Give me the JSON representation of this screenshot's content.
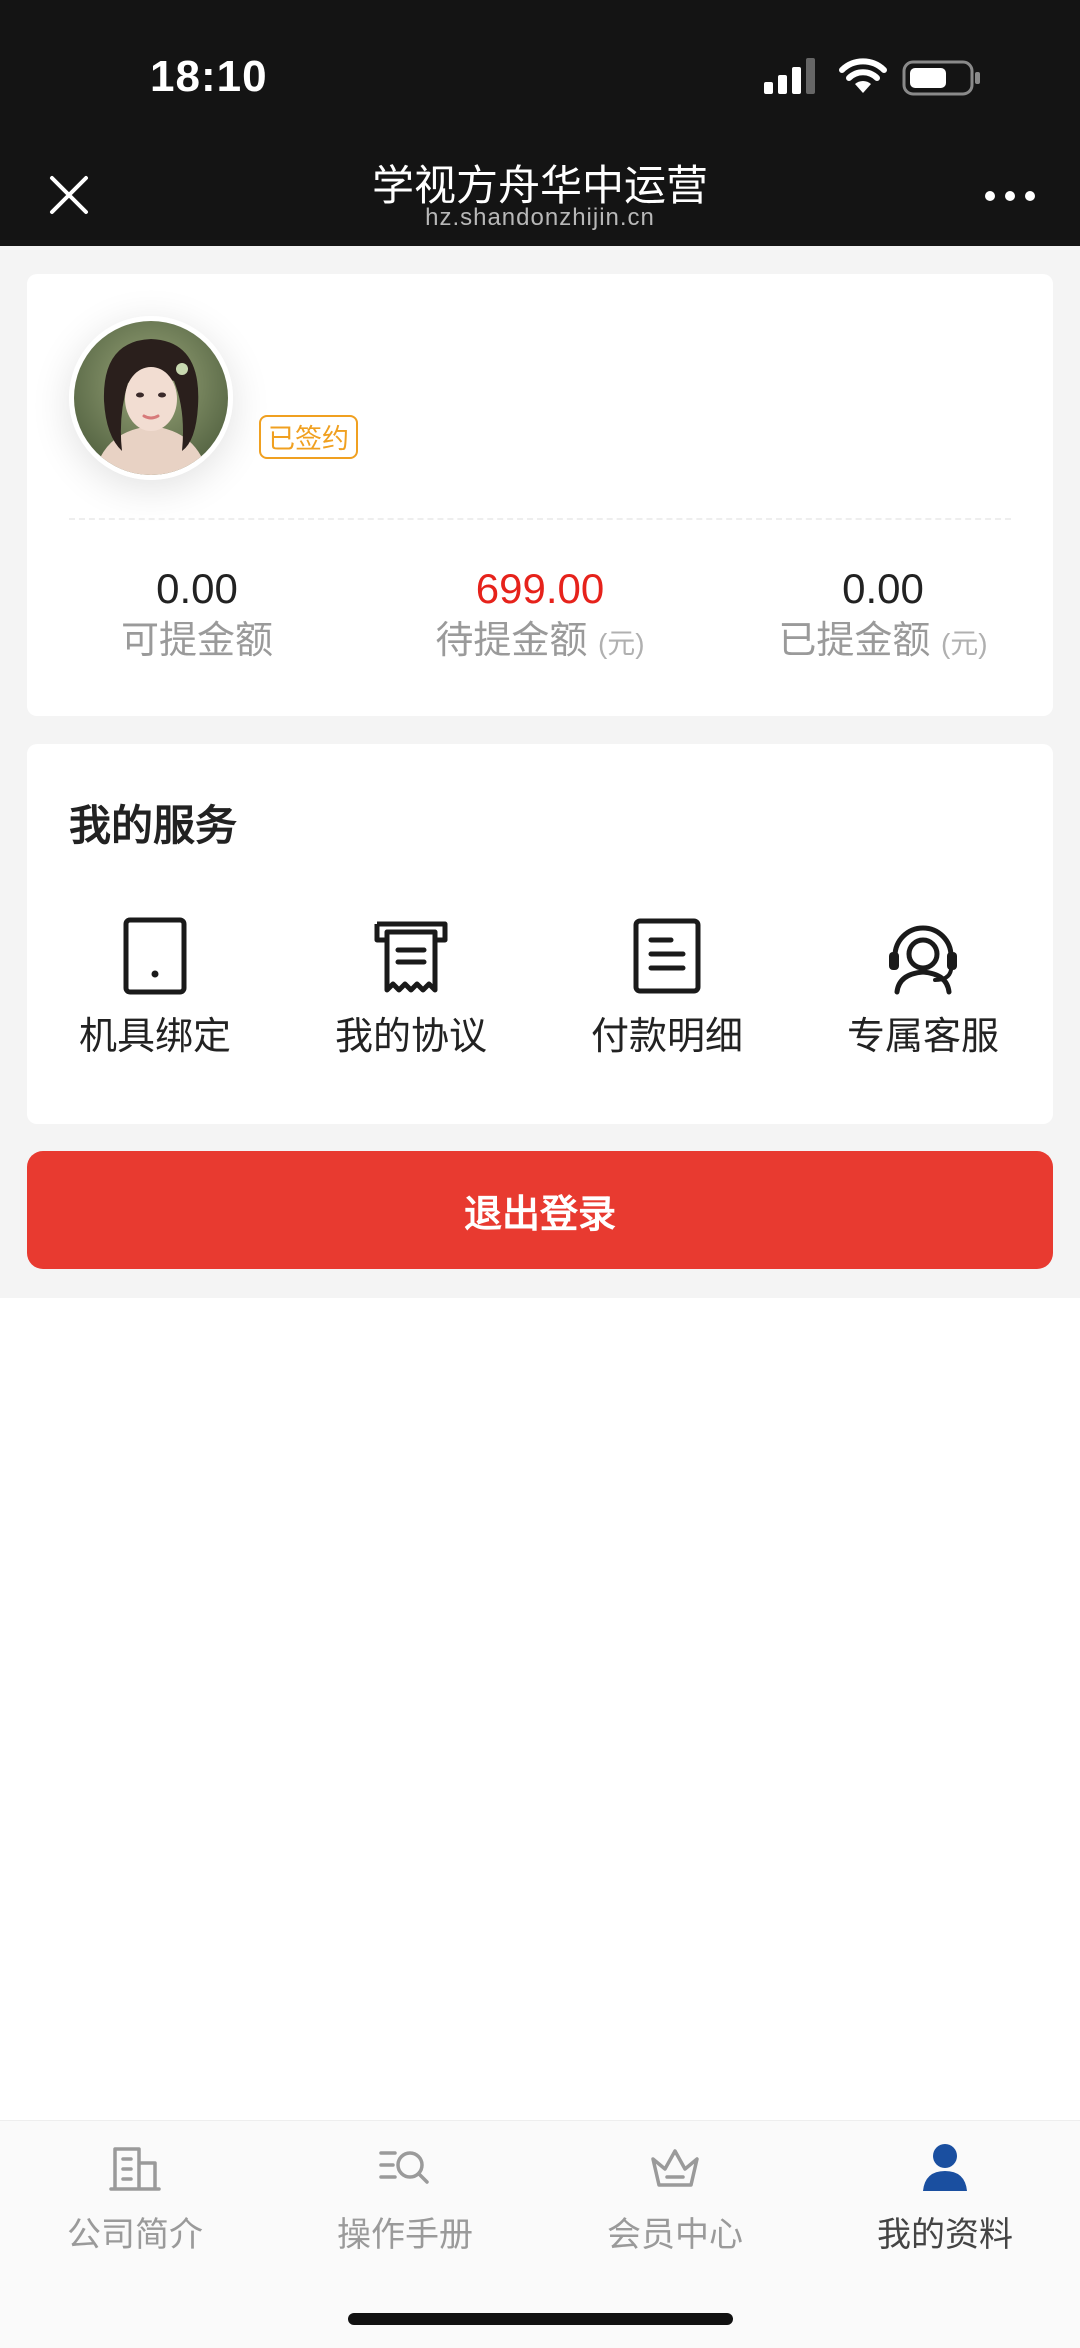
{
  "status_bar": {
    "time": "18:10"
  },
  "nav": {
    "title": "学视方舟华中运营",
    "url": "hz.shandonzhijin.cn"
  },
  "profile": {
    "badge": "已签约",
    "stats": [
      {
        "value": "0.00",
        "label": "可提金额",
        "unit": ""
      },
      {
        "value": "699.00",
        "label": "待提金额",
        "unit": "(元)"
      },
      {
        "value": "0.00",
        "label": "已提金额",
        "unit": "(元)"
      }
    ]
  },
  "services": {
    "title": "我的服务",
    "items": [
      {
        "label": "机具绑定",
        "icon": "tablet-icon"
      },
      {
        "label": "我的协议",
        "icon": "receipt-icon"
      },
      {
        "label": "付款明细",
        "icon": "document-icon"
      },
      {
        "label": "专属客服",
        "icon": "headset-icon"
      }
    ]
  },
  "logout_label": "退出登录",
  "tabs": [
    {
      "label": "公司简介",
      "icon": "building-icon",
      "active": false
    },
    {
      "label": "操作手册",
      "icon": "search-list-icon",
      "active": false
    },
    {
      "label": "会员中心",
      "icon": "crown-icon",
      "active": false
    },
    {
      "label": "我的资料",
      "icon": "user-icon",
      "active": true
    }
  ],
  "colors": {
    "accent_red": "#e83a30",
    "value_red": "#e6221b",
    "badge_orange": "#f0a020",
    "tab_active": "#1a4fa0"
  }
}
